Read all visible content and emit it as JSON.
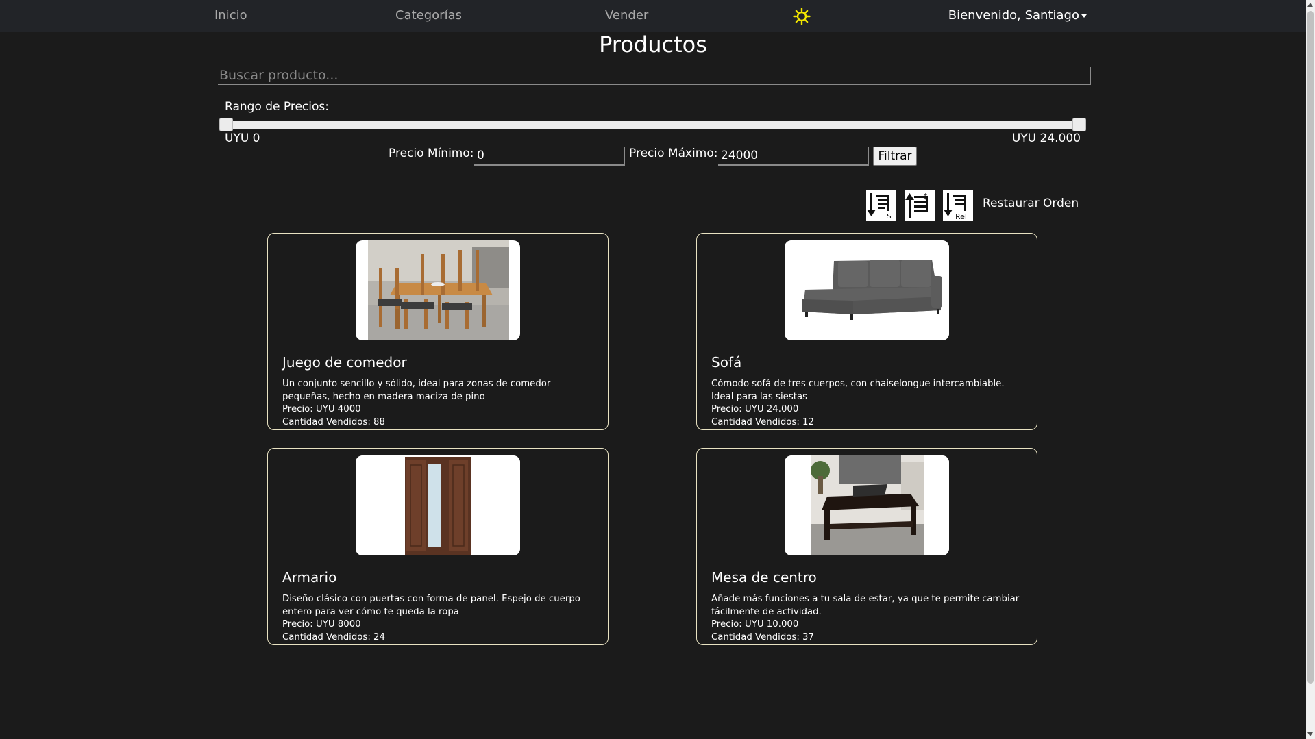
{
  "nav": {
    "items": [
      {
        "label": "Inicio"
      },
      {
        "label": "Categorías"
      },
      {
        "label": "Vender"
      }
    ],
    "theme_icon": "sun-icon",
    "user_label": "Bienvenido, Santiago"
  },
  "page": {
    "title": "Productos"
  },
  "search": {
    "placeholder": "Buscar producto...",
    "value": ""
  },
  "price_range": {
    "label": "Rango de Precios:",
    "min_label": "UYU 0",
    "max_label": "UYU 24.000",
    "min_value": 0,
    "max_value": 24000,
    "slider_min_fraction": 0,
    "slider_max_fraction": 1
  },
  "price_filter": {
    "min_label": "Precio Mínimo:",
    "min_value": "0",
    "max_label": "Precio Máximo:",
    "max_value": "24000",
    "button_label": "Filtrar"
  },
  "sort": {
    "icons": [
      "sort-price-desc-icon",
      "sort-price-asc-icon",
      "sort-relevance-icon"
    ],
    "relevance_badge": "Rel",
    "currency_symbol": "$",
    "reset_label": "Restaurar Orden"
  },
  "products": [
    {
      "name": "Juego de comedor",
      "description": "Un conjunto sencillo y sólido, ideal para zonas de comedor pequeñas, hecho en madera maciza de pino",
      "price": "Precio: UYU 4000",
      "sold": "Cantidad Vendidos: 88",
      "image": "dining-set-image"
    },
    {
      "name": "Sofá",
      "description": "Cómodo sofá de tres cuerpos, con chaiselongue intercambiable. Ideal para las siestas",
      "price": "Precio: UYU 24.000",
      "sold": "Cantidad Vendidos: 12",
      "image": "sofa-image"
    },
    {
      "name": "Armario",
      "description": "Diseño clásico con puertas con forma de panel. Espejo de cuerpo entero para ver cómo te queda la ropa",
      "price": "Precio: UYU 8000",
      "sold": "Cantidad Vendidos: 24",
      "image": "wardrobe-image"
    },
    {
      "name": "Mesa de centro",
      "description": "Añade más funciones a tu sala de estar, ya que te permite cambiar fácilmente de actividad.",
      "price": "Precio: UYU 10.000",
      "sold": "Cantidad Vendidos: 37",
      "image": "coffee-table-image"
    }
  ],
  "colors": {
    "navbar_bg": "#222428",
    "page_bg": "#1b1b1b",
    "card_border": "#e8e2c2",
    "sun_icon": "#f2e600"
  }
}
